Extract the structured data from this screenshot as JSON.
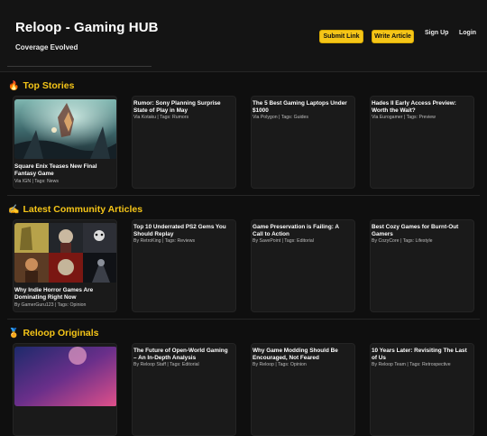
{
  "brand": {
    "title": "Reloop - Gaming HUB",
    "tagline": "Coverage Evolved"
  },
  "nav": {
    "submit_link": "Submit Link",
    "write_article": "Write Article",
    "sign_up": "Sign Up",
    "login": "Login"
  },
  "sections": [
    {
      "emoji": "🔥",
      "title": "Top Stories",
      "cards": [
        {
          "title": "Square Enix Teases New Final Fantasy Game",
          "meta": "Via IGN | Tags: News",
          "image": "fantasy-artwork"
        },
        {
          "title": "Rumor: Sony Planning Surprise State of Play in May",
          "meta": "Via Kotaku | Tags: Rumors"
        },
        {
          "title": "The 5 Best Gaming Laptops Under $1000",
          "meta": "Via Polygon | Tags: Guides"
        },
        {
          "title": "Hades II Early Access Preview: Worth the Wait?",
          "meta": "Via Eurogamer | Tags: Preview"
        }
      ]
    },
    {
      "emoji": "✍️",
      "title": "Latest Community Articles",
      "cards": [
        {
          "title": "Why Indie Horror Games Are Dominating Right Now",
          "meta": "By GamerGuru123 | Tags: Opinion",
          "image": "horror-collage"
        },
        {
          "title": "Top 10 Underrated PS2 Gems You Should Replay",
          "meta": "By RetroKing | Tags: Reviews"
        },
        {
          "title": "Game Preservation is Failing: A Call to Action",
          "meta": "By SavePoint | Tags: Editorial"
        },
        {
          "title": "Best Cozy Games for Burnt-Out Gamers",
          "meta": "By CozyCore | Tags: Lifestyle"
        }
      ]
    },
    {
      "emoji": "🏅",
      "title": "Reloop Originals",
      "cards": [
        {
          "title": "",
          "meta": "",
          "image": "originals-artwork"
        },
        {
          "title": "The Future of Open-World Gaming – An In-Depth Analysis",
          "meta": "By Reloop Staff | Tags: Editorial"
        },
        {
          "title": "Why Game Modding Should Be Encouraged, Not Feared",
          "meta": "By Reloop | Tags: Opinion"
        },
        {
          "title": "10 Years Later: Revisiting The Last of Us",
          "meta": "By Reloop Team | Tags: Retrospective"
        }
      ]
    }
  ]
}
